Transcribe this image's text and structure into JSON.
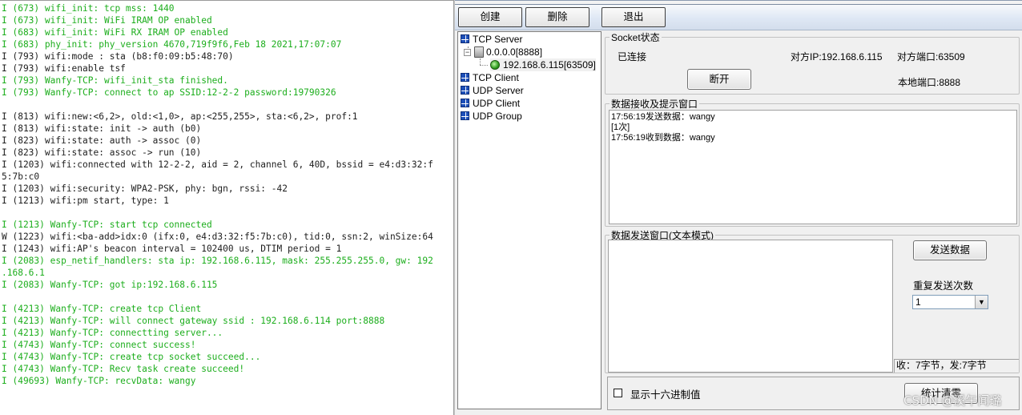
{
  "terminal": {
    "lines": [
      {
        "text": "I (673) wifi_init: tcp mss: 1440",
        "color": "green"
      },
      {
        "text": "I (673) wifi_init: WiFi IRAM OP enabled",
        "color": "green"
      },
      {
        "text": "I (683) wifi_init: WiFi RX IRAM OP enabled",
        "color": "green"
      },
      {
        "text": "I (683) phy_init: phy_version 4670,719f9f6,Feb 18 2021,17:07:07",
        "color": "green"
      },
      {
        "text": "I (793) wifi:mode : sta (b8:f0:09:b5:48:70)",
        "color": "white"
      },
      {
        "text": "I (793) wifi:enable tsf",
        "color": "white"
      },
      {
        "text": "I (793) Wanfy-TCP: wifi_init_sta finished.",
        "color": "green"
      },
      {
        "text": "I (793) Wanfy-TCP: connect to ap SSID:12-2-2 password:19790326",
        "color": "green"
      },
      {
        "text": "",
        "color": "white"
      },
      {
        "text": "I (813) wifi:new:<6,2>, old:<1,0>, ap:<255,255>, sta:<6,2>, prof:1",
        "color": "white"
      },
      {
        "text": "I (813) wifi:state: init -> auth (b0)",
        "color": "white"
      },
      {
        "text": "I (823) wifi:state: auth -> assoc (0)",
        "color": "white"
      },
      {
        "text": "I (823) wifi:state: assoc -> run (10)",
        "color": "white"
      },
      {
        "text": "I (1203) wifi:connected with 12-2-2, aid = 2, channel 6, 40D, bssid = e4:d3:32:f",
        "color": "white"
      },
      {
        "text": "5:7b:c0",
        "color": "white"
      },
      {
        "text": "I (1203) wifi:security: WPA2-PSK, phy: bgn, rssi: -42",
        "color": "white"
      },
      {
        "text": "I (1213) wifi:pm start, type: 1",
        "color": "white"
      },
      {
        "text": "",
        "color": "white"
      },
      {
        "text": "I (1213) Wanfy-TCP: start tcp connected",
        "color": "green"
      },
      {
        "text": "W (1223) wifi:<ba-add>idx:0 (ifx:0, e4:d3:32:f5:7b:c0), tid:0, ssn:2, winSize:64",
        "color": "white"
      },
      {
        "text": "I (1243) wifi:AP's beacon interval = 102400 us, DTIM period = 1",
        "color": "white"
      },
      {
        "text": "I (2083) esp_netif_handlers: sta ip: 192.168.6.115, mask: 255.255.255.0, gw: 192",
        "color": "green"
      },
      {
        "text": ".168.6.1",
        "color": "green"
      },
      {
        "text": "I (2083) Wanfy-TCP: got ip:192.168.6.115",
        "color": "green"
      },
      {
        "text": "",
        "color": "white"
      },
      {
        "text": "I (4213) Wanfy-TCP: create tcp Client",
        "color": "green"
      },
      {
        "text": "I (4213) Wanfy-TCP: will connect gateway ssid : 192.168.6.114 port:8888",
        "color": "green"
      },
      {
        "text": "I (4213) Wanfy-TCP: connectting server...",
        "color": "green"
      },
      {
        "text": "I (4743) Wanfy-TCP: connect success!",
        "color": "green"
      },
      {
        "text": "I (4743) Wanfy-TCP: create tcp socket succeed...",
        "color": "green"
      },
      {
        "text": "I (4743) Wanfy-TCP: Recv task create succeed!",
        "color": "green"
      },
      {
        "text": "I (49693) Wanfy-TCP: recvData: wangy",
        "color": "green"
      }
    ],
    "colors": {
      "green": "#1dae1d",
      "white": "#1e1e1e"
    }
  },
  "toolbar": {
    "create_label": "创建",
    "delete_label": "删除",
    "exit_label": "退出"
  },
  "tree": {
    "tcp_server": "TCP Server",
    "listen_node": "0.0.0.0[8888]",
    "client_node": "192.168.6.115[63509]",
    "tcp_client": "TCP Client",
    "udp_server": "UDP Server",
    "udp_client": "UDP Client",
    "udp_group": "UDP Group"
  },
  "socket_status": {
    "legend": "Socket状态",
    "state": "已连接",
    "peer_ip": "对方IP:192.168.6.115",
    "peer_port": "对方端口:63509",
    "disconnect_label": "断开",
    "local_port": "本地端口:8888"
  },
  "receive": {
    "legend": "数据接收及提示窗口",
    "messages": [
      "17:56:19发送数据：wangy",
      "[1次]",
      "17:56:19收到数据：wangy"
    ]
  },
  "send": {
    "legend": "数据发送窗口(文本模式)",
    "input_value": "",
    "send_label": "发送数据",
    "repeat_label": "重复发送次数",
    "repeat_value": "1",
    "counter": "收：7字节，发:7字节"
  },
  "options": {
    "hex_label": "显示十六进制值",
    "hex_checked": false,
    "stats_clear_label": "统计清零"
  },
  "watermark": "CSDN @溪午闻璐"
}
